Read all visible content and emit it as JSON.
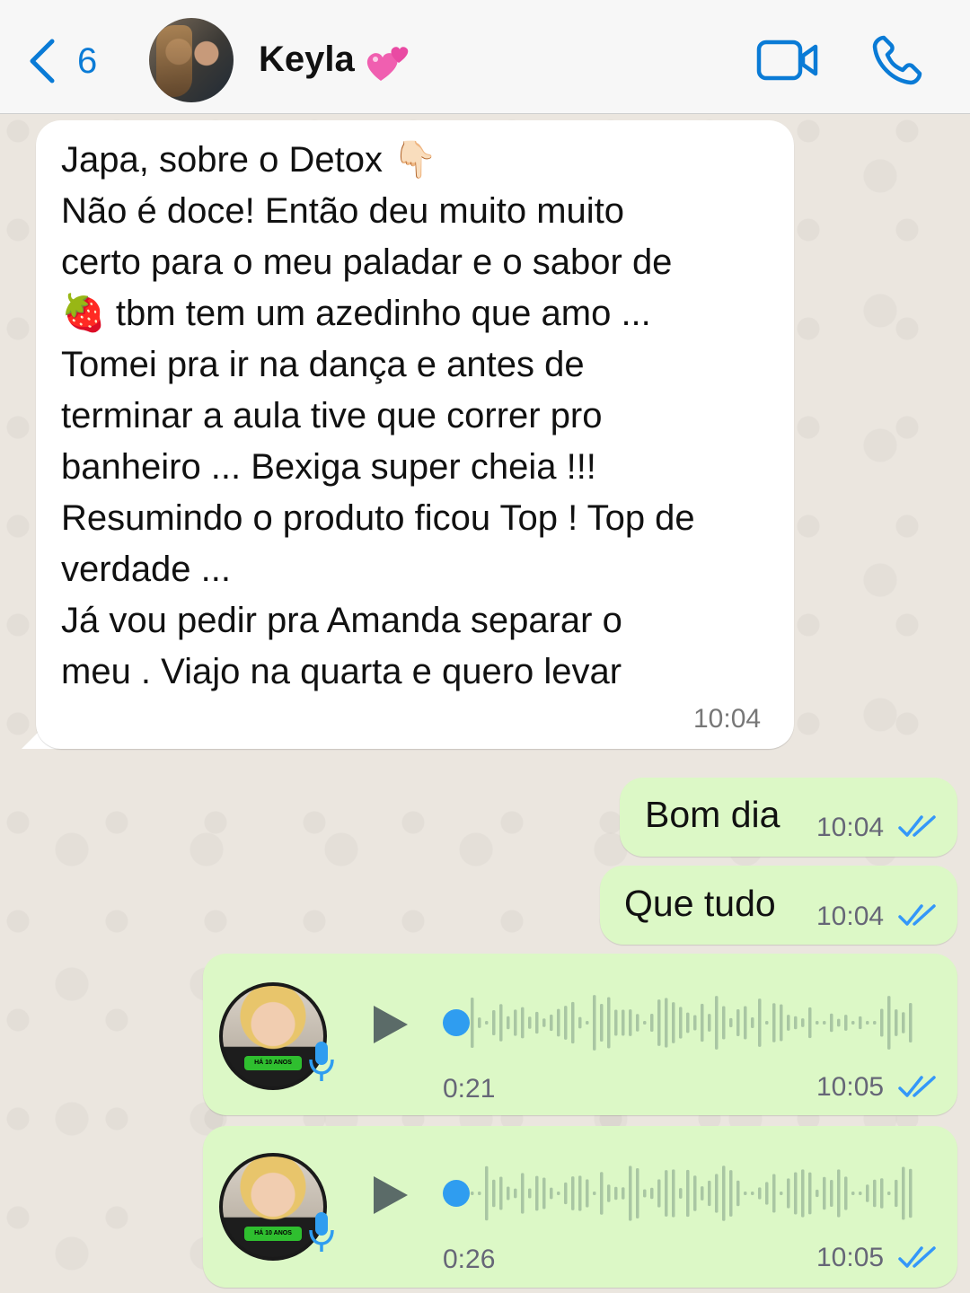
{
  "header": {
    "back_count": "6",
    "contact_name": "Keyla",
    "contact_emoji": "💕"
  },
  "incoming": {
    "lines": [
      "Japa, sobre o Detox 👇🏻",
      "Não é doce! Então deu  muito muito",
      "certo para o meu paladar e o sabor de",
      "🍓 tbm tem um azedinho que amo ...",
      "Tomei pra ir na dança e antes de",
      "terminar a aula tive que correr pro",
      "banheiro ... Bexiga super cheia !!!",
      "Resumindo o produto ficou Top ! Top de",
      "verdade ...",
      "Já vou pedir pra Amanda separar o",
      "meu . Viajo na quarta e quero levar"
    ],
    "time": "10:04"
  },
  "outgoing": [
    {
      "text": "Bom dia",
      "time": "10:04",
      "status": "read"
    },
    {
      "text": "Que tudo",
      "time": "10:04",
      "status": "read"
    }
  ],
  "voice_notes": [
    {
      "duration": "0:21",
      "time": "10:05",
      "status": "read",
      "avatar_label": "HÁ 10 ANOS",
      "progress": 0
    },
    {
      "duration": "0:26",
      "time": "10:05",
      "status": "read",
      "avatar_label": "HÁ 10 ANOS",
      "progress": 0
    }
  ],
  "colors": {
    "accent": "#0a7bd6",
    "outgoing_bubble": "#dcf8c6",
    "read_ticks": "#3497f9",
    "scrub_dot": "#2f9df0"
  }
}
